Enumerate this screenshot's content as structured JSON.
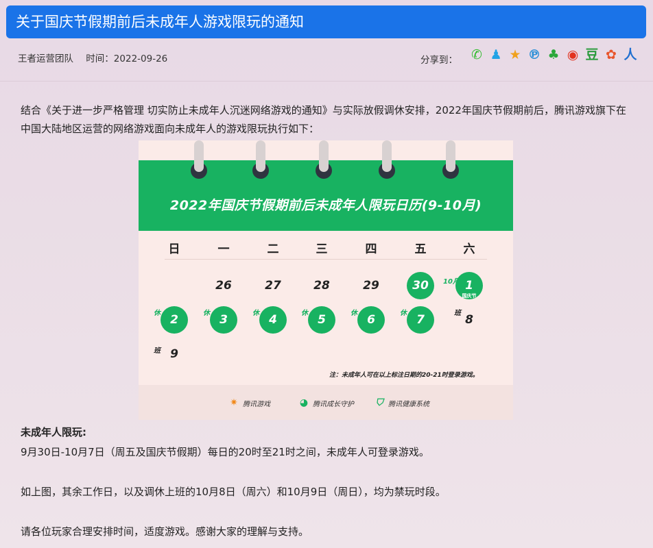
{
  "header": {
    "title": "关于国庆节假期前后未成年人游戏限玩的通知"
  },
  "meta": {
    "author": "王者运营团队",
    "time_label": "时间：",
    "time_value": "2022-09-26",
    "share_label": "分享到："
  },
  "share_icons": [
    {
      "name": "wechat-icon",
      "glyph": "✆",
      "color": "#2dbb2a"
    },
    {
      "name": "qq-icon",
      "glyph": "♟",
      "color": "#22a3e6"
    },
    {
      "name": "qzone-icon",
      "glyph": "★",
      "color": "#f0a11c"
    },
    {
      "name": "tencent-weibo-icon",
      "glyph": "℗",
      "color": "#2a8fd7"
    },
    {
      "name": "clover-icon",
      "glyph": "♣",
      "color": "#2aa83a"
    },
    {
      "name": "sina-weibo-icon",
      "glyph": "◉",
      "color": "#e2331f"
    },
    {
      "name": "douban-icon",
      "glyph": "豆",
      "color": "#2a9a3c"
    },
    {
      "name": "renren-icon",
      "glyph": "✿",
      "color": "#e8542b"
    },
    {
      "name": "kaixin-icon",
      "glyph": "人",
      "color": "#1f6fd0"
    }
  ],
  "intro": "结合《关于进一步严格管理 切实防止未成年人沉迷网络游戏的通知》与实际放假调休安排，2022年国庆节假期前后，腾讯游戏旗下在中国大陆地区运营的网络游戏面向未成年人的游戏限玩执行如下：",
  "calendar": {
    "title": "2022年国庆节假期前后未成年人限玩日历(9-10月)",
    "weekdays": [
      "日",
      "一",
      "二",
      "三",
      "四",
      "五",
      "六"
    ],
    "row1": [
      "26",
      "27",
      "28",
      "29",
      "30",
      "1"
    ],
    "row2": [
      "2",
      "3",
      "4",
      "5",
      "6",
      "7",
      "8"
    ],
    "row3": [
      "9"
    ],
    "rest_tag": "休",
    "work_tag": "班",
    "month_tag": "10月",
    "holiday_sub": "国庆节",
    "note": "注：未成年人可在以上标注日期的20-21时登录游戏。",
    "footer": {
      "tencent_games": "腾讯游戏",
      "growth_guard": "腾讯成长守护",
      "health_system": "腾讯健康系统"
    },
    "accent": "#18b261"
  },
  "section": {
    "heading": "未成年人限玩:",
    "p1": "9月30日-10月7日（周五及国庆节假期）每日的20时至21时之间，未成年人可登录游戏。",
    "p2": "如上图，其余工作日，以及调休上班的10月8日（周六）和10月9日（周日），均为禁玩时段。",
    "p3": "请各位玩家合理安排时间，适度游戏。感谢大家的理解与支持。"
  }
}
